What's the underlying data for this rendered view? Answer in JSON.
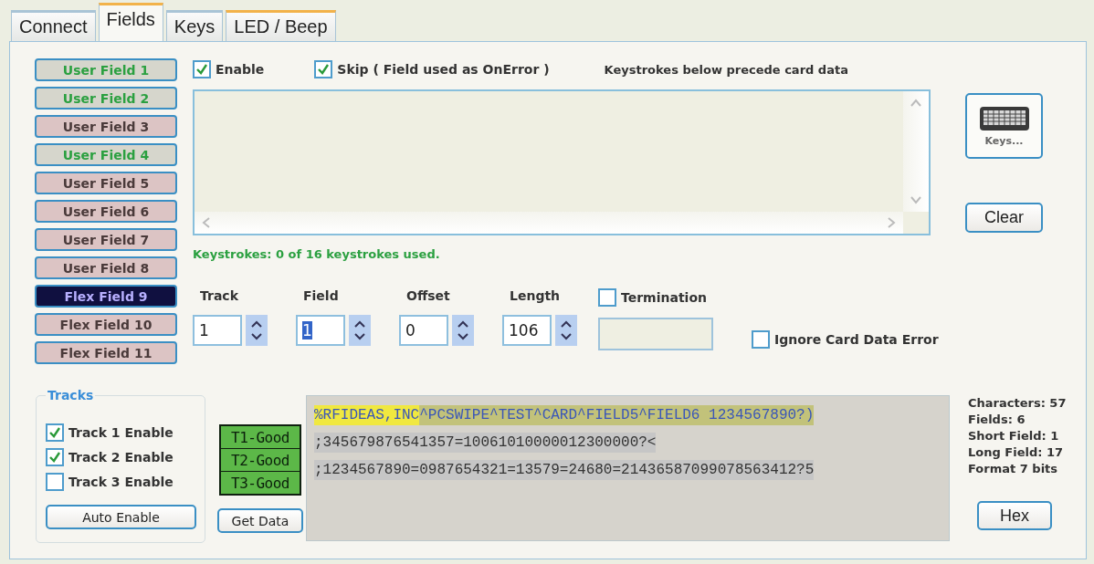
{
  "tabs": [
    {
      "label": "Connect",
      "selected": false,
      "hot": false
    },
    {
      "label": "Fields",
      "selected": true,
      "hot": false
    },
    {
      "label": "Keys",
      "selected": false,
      "hot": false
    },
    {
      "label": "LED / Beep",
      "selected": false,
      "hot": true
    }
  ],
  "field_buttons": [
    {
      "label": "User Field 1",
      "enabled": true,
      "selected": false
    },
    {
      "label": "User Field 2",
      "enabled": true,
      "selected": false
    },
    {
      "label": "User Field 3",
      "enabled": false,
      "selected": false
    },
    {
      "label": "User Field 4",
      "enabled": true,
      "selected": false
    },
    {
      "label": "User Field 5",
      "enabled": false,
      "selected": false
    },
    {
      "label": "User Field 6",
      "enabled": false,
      "selected": false
    },
    {
      "label": "User Field 7",
      "enabled": false,
      "selected": false
    },
    {
      "label": "User Field 8",
      "enabled": false,
      "selected": false
    },
    {
      "label": "Flex Field 9",
      "enabled": false,
      "selected": true
    },
    {
      "label": "Flex Field 10",
      "enabled": false,
      "selected": false
    },
    {
      "label": "Flex Field 11",
      "enabled": false,
      "selected": false
    }
  ],
  "enable": {
    "label": "Enable",
    "checked": true
  },
  "skip": {
    "label": "Skip ( Field used as OnError )",
    "checked": true
  },
  "keystrokes_caption": "Keystrokes below precede card data",
  "keys_button": "Keys...",
  "clear_button": "Clear",
  "keystrokes_status": "Keystrokes: 0 of 16 keystrokes used.",
  "spinners": [
    {
      "label": "Track",
      "value": "1",
      "highlighted": false
    },
    {
      "label": "Field",
      "value": "1",
      "highlighted": true
    },
    {
      "label": "Offset",
      "value": "0",
      "highlighted": false
    },
    {
      "label": "Length",
      "value": "106",
      "highlighted": false
    }
  ],
  "termination": {
    "label": "Termination",
    "checked": false
  },
  "ignore_error": {
    "label": "Ignore Card Data Error",
    "checked": false
  },
  "tracks": {
    "title": "Tracks",
    "items": [
      {
        "label": "Track 1 Enable",
        "checked": true
      },
      {
        "label": "Track 2 Enable",
        "checked": true
      },
      {
        "label": "Track 3 Enable",
        "checked": false
      }
    ],
    "button": "Auto Enable"
  },
  "track_status": [
    "T1-Good",
    "T2-Good",
    "T3-Good"
  ],
  "get_data_button": "Get Data",
  "card_data": [
    {
      "active": true,
      "segments": [
        {
          "text": "%RFIDEAS,INC",
          "selected": true
        },
        {
          "text": "^PCSWIPE^TEST^CARD^FIELD5^FIELD6 1234567890?)",
          "selected": false
        }
      ]
    },
    {
      "active": false,
      "segments": [
        {
          "text": ";345679876541357=10061010000012300000?<",
          "selected": false
        }
      ]
    },
    {
      "active": false,
      "segments": [
        {
          "text": ";1234567890=0987654321=13579=24680=21436587099078563412?5",
          "selected": false
        }
      ]
    }
  ],
  "stats": [
    "Characters: 57",
    "Fields: 6",
    "Short Field: 1",
    "Long Field: 17",
    "Format 7 bits"
  ],
  "hex_button": "Hex"
}
